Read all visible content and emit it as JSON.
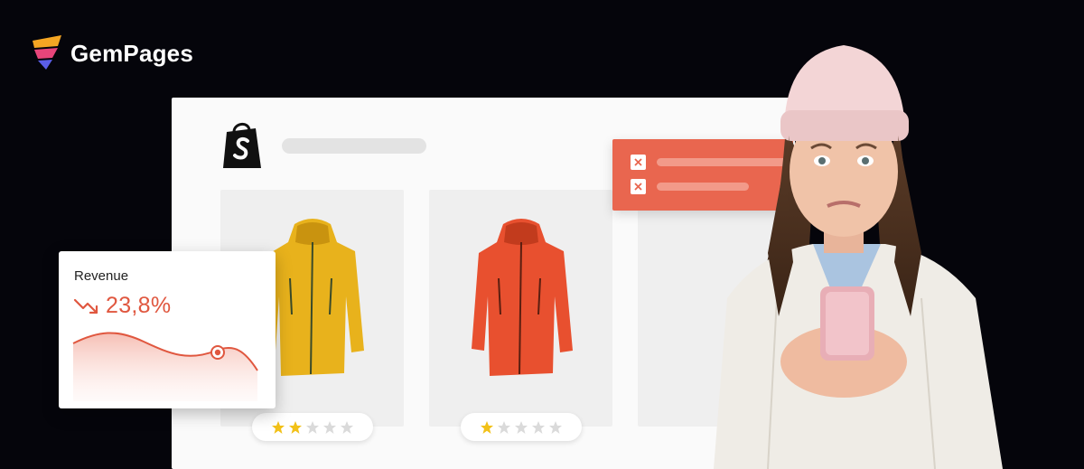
{
  "brand": {
    "name": "GemPages",
    "logo_icon": "gempages-logo-icon"
  },
  "store": {
    "platform_icon": "shopify-bag-icon",
    "products": [
      {
        "name": "yellow-jacket",
        "color": "#e8b21c",
        "rating": 2,
        "max_rating": 5
      },
      {
        "name": "orange-jacket",
        "color": "#e8502f",
        "rating": 1,
        "max_rating": 5
      }
    ]
  },
  "error_panel": {
    "icon": "close-icon",
    "color": "#e9664f"
  },
  "revenue": {
    "title": "Revenue",
    "value": "23,8%",
    "trend_icon": "trend-down-icon",
    "accent": "#e0573f"
  },
  "colors": {
    "background": "#05050b",
    "star_filled": "#f2c118",
    "star_empty": "#dadada"
  }
}
